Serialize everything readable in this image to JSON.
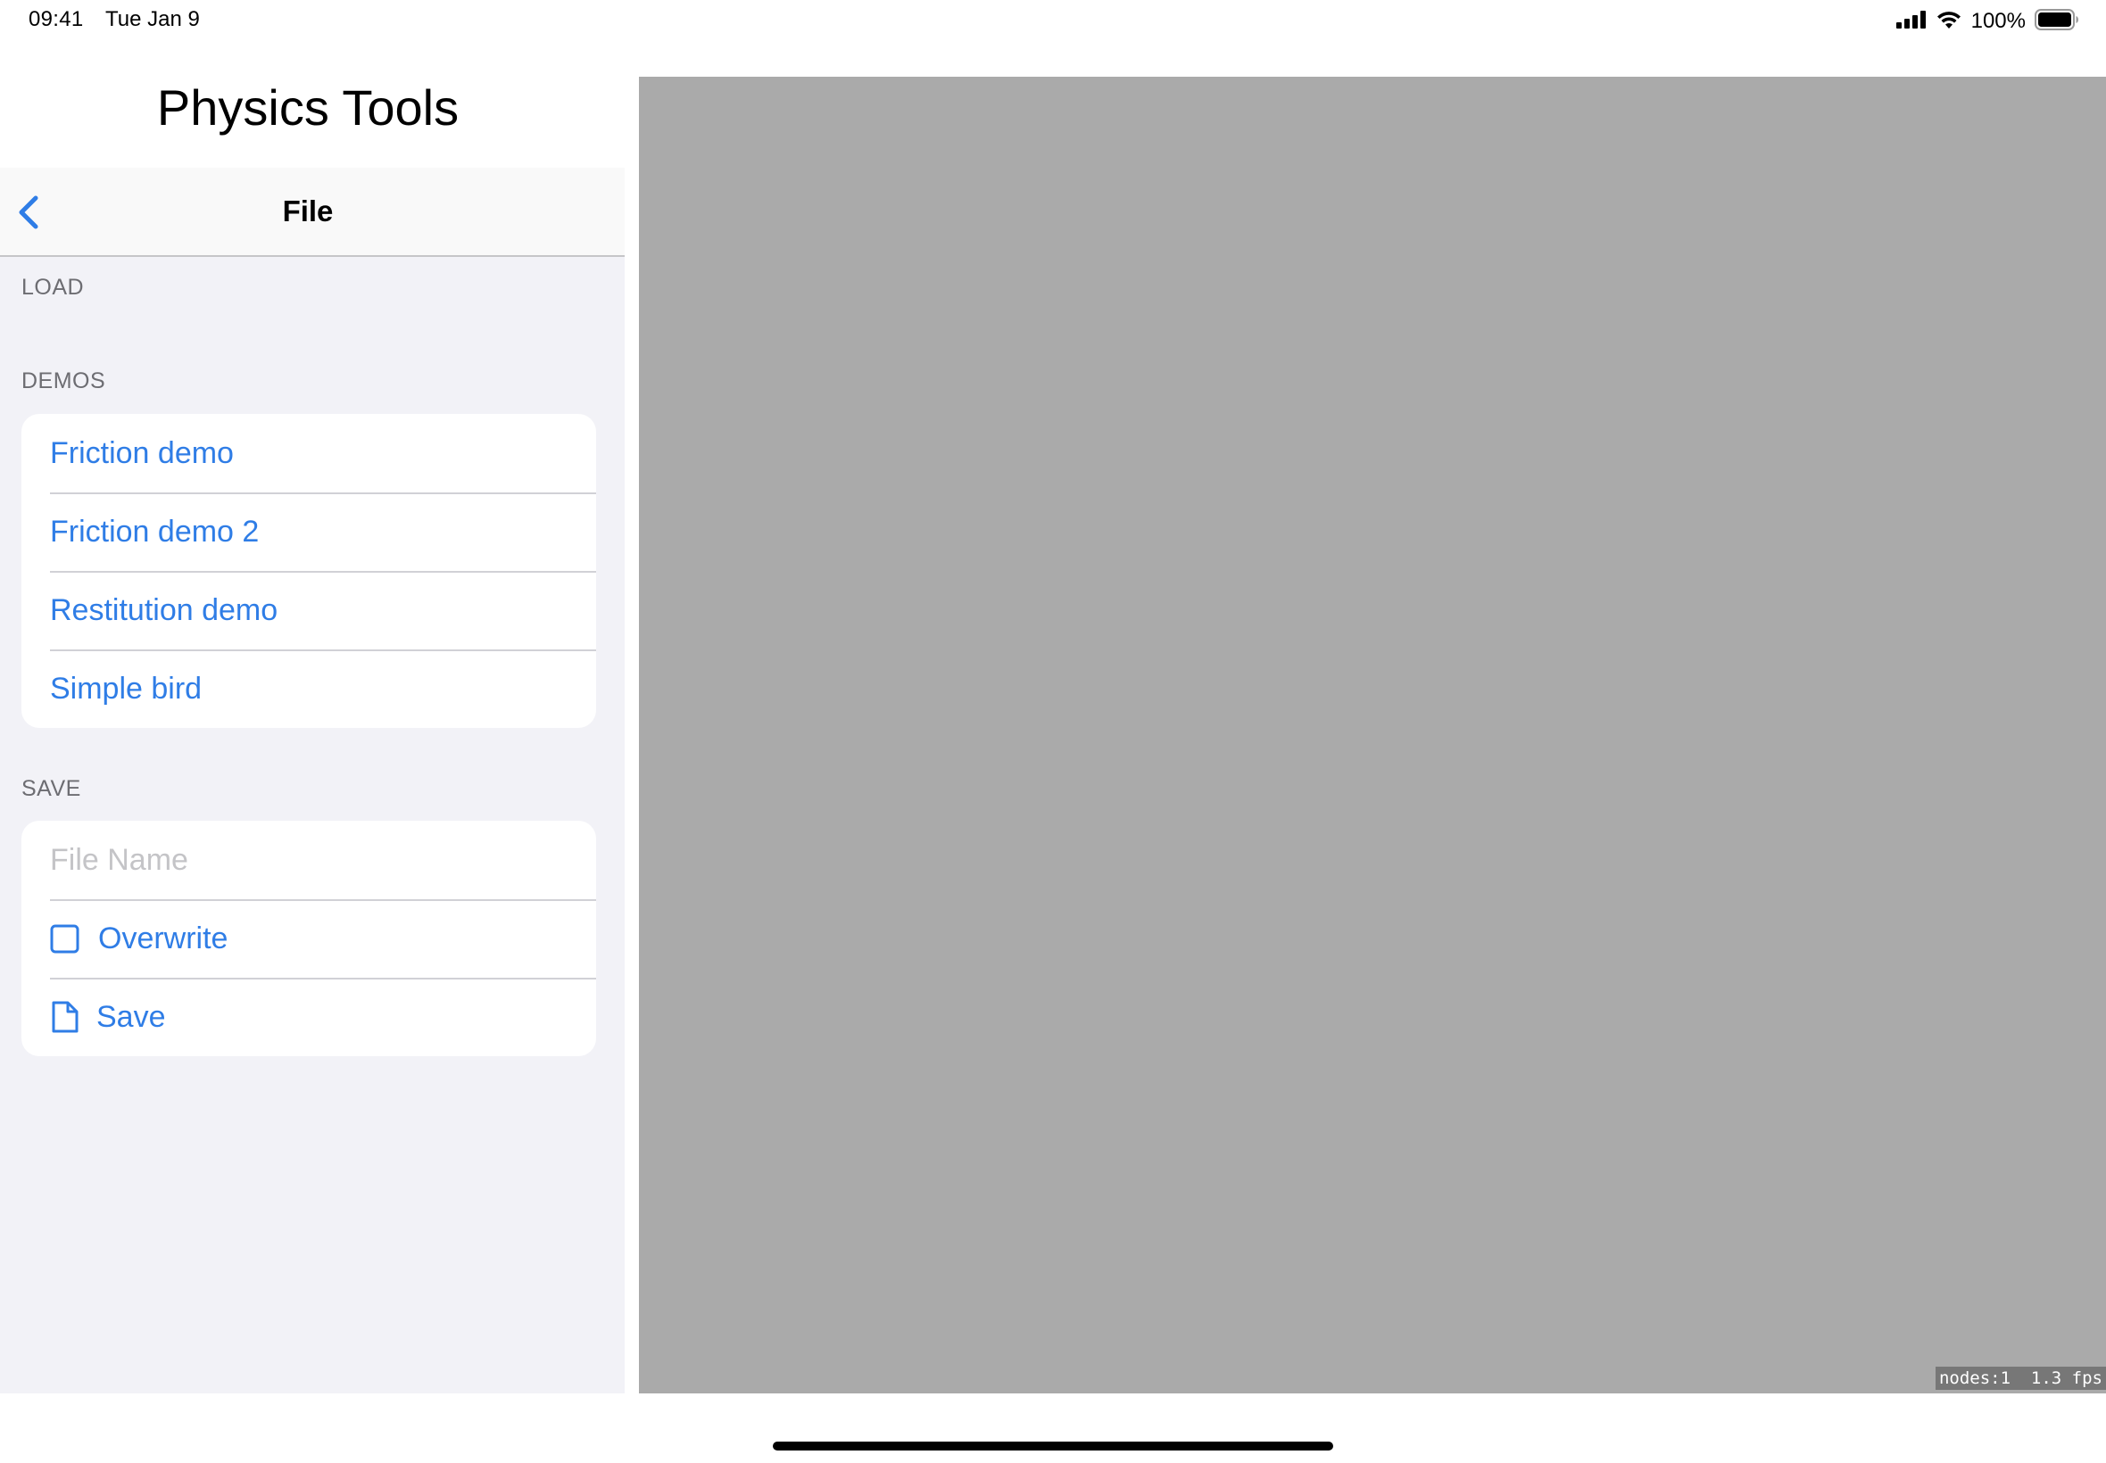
{
  "status_bar": {
    "time": "09:41",
    "date": "Tue Jan 9",
    "battery": "100%",
    "icons": [
      "signal-icon",
      "wifi-icon",
      "battery-icon"
    ]
  },
  "sidebar": {
    "app_title": "Physics Tools",
    "nav_title": "File",
    "back_icon": "chevron-left-icon",
    "sections": {
      "load": {
        "header": "LOAD"
      },
      "demos": {
        "header": "DEMOS",
        "items": [
          {
            "label": "Friction demo"
          },
          {
            "label": "Friction demo 2"
          },
          {
            "label": "Restitution demo"
          },
          {
            "label": "Simple bird"
          }
        ]
      },
      "save": {
        "header": "SAVE",
        "file_name": {
          "value": "",
          "placeholder": "File Name"
        },
        "overwrite": {
          "label": "Overwrite",
          "checked": false,
          "icon": "checkbox-icon"
        },
        "save_button": {
          "label": "Save",
          "icon": "document-icon"
        }
      }
    }
  },
  "sim_view": {
    "stats": "nodes:1  1.3 fps"
  },
  "colors": {
    "accent": "#2f7de6",
    "grouped_background": "#f2f2f7",
    "sim_background": "#aaaaaa",
    "section_header": "#6d6d72"
  }
}
